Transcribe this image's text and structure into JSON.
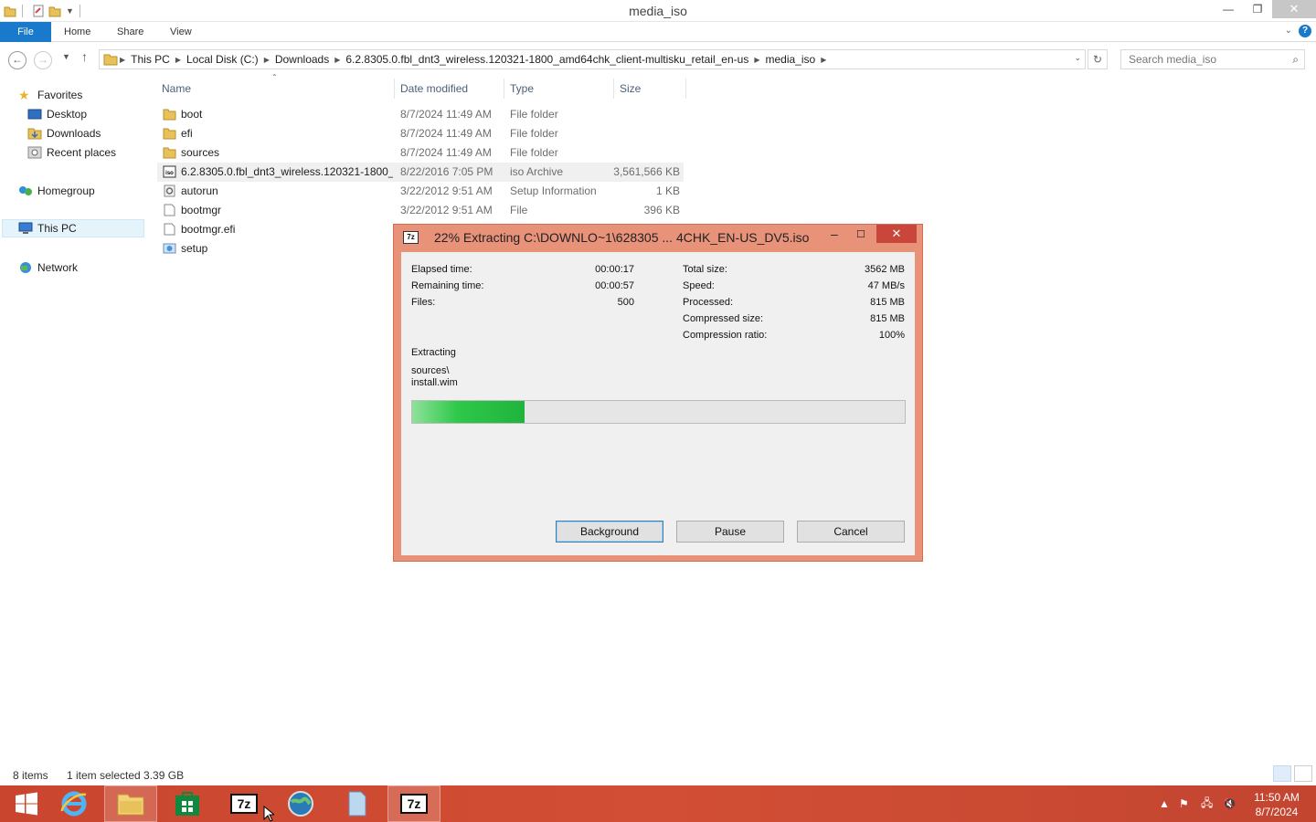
{
  "window": {
    "title": "media_iso",
    "minimize_glyph": "—",
    "restore_glyph": "❐",
    "close_glyph": "✕"
  },
  "ribbon": {
    "tabs": [
      "File",
      "Home",
      "Share",
      "View"
    ],
    "help": "?"
  },
  "address": {
    "crumbs": [
      "This PC",
      "Local Disk (C:)",
      "Downloads",
      "6.2.8305.0.fbl_dnt3_wireless.120321-1800_amd64chk_client-multisku_retail_en-us",
      "media_iso"
    ],
    "search_placeholder": "Search media_iso"
  },
  "navpane": {
    "favorites": "Favorites",
    "desktop": "Desktop",
    "downloads": "Downloads",
    "recent": "Recent places",
    "homegroup": "Homegroup",
    "thispc": "This PC",
    "network": "Network"
  },
  "columns": {
    "name": "Name",
    "date": "Date modified",
    "type": "Type",
    "size": "Size"
  },
  "files": [
    {
      "name": "boot",
      "date": "8/7/2024 11:49 AM",
      "type": "File folder",
      "size": "",
      "icon": "folder-icon"
    },
    {
      "name": "efi",
      "date": "8/7/2024 11:49 AM",
      "type": "File folder",
      "size": "",
      "icon": "folder-icon"
    },
    {
      "name": "sources",
      "date": "8/7/2024 11:49 AM",
      "type": "File folder",
      "size": "",
      "icon": "folder-icon"
    },
    {
      "name": "6.2.8305.0.fbl_dnt3_wireless.120321-1800_...",
      "date": "8/22/2016 7:05 PM",
      "type": "iso Archive",
      "size": "3,561,566 KB",
      "icon": "iso-file-icon"
    },
    {
      "name": "autorun",
      "date": "3/22/2012 9:51 AM",
      "type": "Setup Information",
      "size": "1 KB",
      "icon": "settings-file-icon"
    },
    {
      "name": "bootmgr",
      "date": "3/22/2012 9:51 AM",
      "type": "File",
      "size": "396 KB",
      "icon": "blank-file-icon"
    },
    {
      "name": "bootmgr.efi",
      "date": "",
      "type": "",
      "size": "",
      "icon": "blank-file-icon"
    },
    {
      "name": "setup",
      "date": "",
      "type": "",
      "size": "",
      "icon": "setup-app-icon"
    }
  ],
  "status": {
    "items": "8 items",
    "selected": "1 item selected  3.39 GB"
  },
  "dialog": {
    "title": "22% Extracting C:\\DOWNLO~1\\628305 ... 4CHK_EN-US_DV5.iso",
    "app_icon": "7z",
    "elapsed_label": "Elapsed time:",
    "elapsed": "00:00:17",
    "remaining_label": "Remaining time:",
    "remaining": "00:00:57",
    "files_label": "Files:",
    "files": "500",
    "total_label": "Total size:",
    "total": "3562 MB",
    "speed_label": "Speed:",
    "speed": "47 MB/s",
    "processed_label": "Processed:",
    "processed": "815 MB",
    "compressed_label": "Compressed size:",
    "compressed": "815 MB",
    "ratio_label": "Compression ratio:",
    "ratio": "100%",
    "action": "Extracting",
    "path_line1": "sources\\",
    "path_line2": "install.wim",
    "progress_fraction": 0.228,
    "buttons": {
      "background": "Background",
      "pause": "Pause",
      "cancel": "Cancel"
    }
  },
  "taskbar": {
    "sevenzip_label": "7z",
    "clock_time": "11:50 AM",
    "clock_date": "8/7/2024"
  },
  "colors": {
    "accent": "#1979ca",
    "dialog_frame": "#e8927a",
    "taskbar": "#c9452e",
    "progress": "#1fb43c"
  }
}
